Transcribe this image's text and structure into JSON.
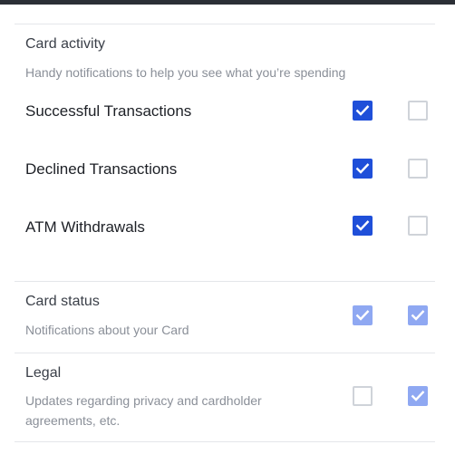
{
  "card_activity": {
    "title": "Card activity",
    "description": "Handy notifications to help you see what you’re spending",
    "rows": [
      {
        "label": "Successful Transactions",
        "col1_checked": true,
        "col2_checked": false
      },
      {
        "label": "Declined Transactions",
        "col1_checked": true,
        "col2_checked": false
      },
      {
        "label": "ATM Withdrawals",
        "col1_checked": true,
        "col2_checked": false
      }
    ]
  },
  "card_status": {
    "title": "Card status",
    "description": "Notifications about your Card",
    "col1_checked": true,
    "col2_checked": true,
    "disabled": true
  },
  "legal": {
    "title": "Legal",
    "description": "Updates regarding privacy and cardholder agreements, etc.",
    "col1_checked": false,
    "col2_checked": true,
    "disabled": true
  },
  "colors": {
    "checked": "#1f4fd9",
    "checked_disabled": "#8fa8f2",
    "unchecked_border": "#cfd3d9",
    "topbar": "#2b2f36"
  }
}
